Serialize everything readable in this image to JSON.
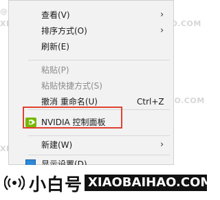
{
  "menu": {
    "items": [
      {
        "label": "查看(V)",
        "arrow": "›"
      },
      {
        "label": "排序方式(O)",
        "arrow": "›"
      },
      {
        "label": "刷新(E)"
      },
      {
        "label": "粘贴(P)"
      },
      {
        "label": "粘贴快捷方式(S)"
      },
      {
        "label": "撤消 重命名(U)",
        "shortcut": "Ctrl+Z"
      },
      {
        "label": "NVIDIA 控制面板"
      },
      {
        "label": "新建(W)",
        "arrow": "›"
      },
      {
        "label": "显示设置(D)"
      }
    ]
  },
  "watermarks": [
    "@小白号",
    "XIAOBAIHAO.COM"
  ],
  "brand": {
    "name": "小白号",
    "domain": "XIAOBAIHAO.COM"
  },
  "colors": {
    "menu_bg": "#f2f2f2",
    "highlight_border": "#e04030",
    "nvidia_green": "#76b900",
    "disabled_text": "#8c8c8c"
  },
  "icons": {
    "nvidia": "nvidia-logo-icon",
    "display": "display-settings-icon",
    "submenu": "chevron-right-icon",
    "brand": "signal-broadcast-icon"
  }
}
